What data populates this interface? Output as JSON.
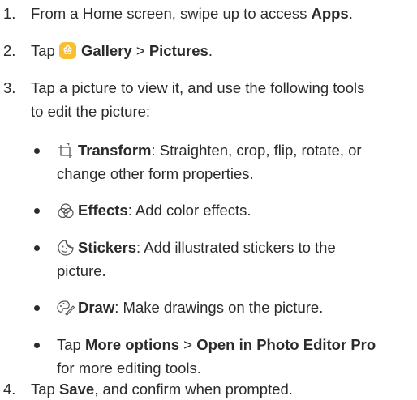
{
  "steps": [
    {
      "num": "1.",
      "prefix": "From a Home screen, swipe up to access ",
      "bold": "Apps",
      "suffix": "."
    },
    {
      "num": "2.",
      "prefix": "Tap ",
      "icon": "gallery-icon",
      "bold1": "Gallery",
      "sep": " > ",
      "bold2": "Pictures",
      "suffix": "."
    },
    {
      "num": "3.",
      "line1": "Tap a picture to view it, and use the following tools",
      "line2": "to edit the picture:"
    },
    {
      "num": "4.",
      "prefix": "Tap ",
      "bold": "Save",
      "suffix": ", and confirm when prompted."
    }
  ],
  "tools": [
    {
      "icon": "transform-icon",
      "name": "Transform",
      "desc_line1": ": Straighten, crop, flip, rotate, or",
      "desc_line2": "change other form properties."
    },
    {
      "icon": "effects-icon",
      "name": "Effects",
      "desc_line1": ": Add color effects."
    },
    {
      "icon": "stickers-icon",
      "name": "Stickers",
      "desc_line1": ": Add illustrated stickers to the",
      "desc_line2": "picture."
    },
    {
      "icon": "draw-icon",
      "name": "Draw",
      "desc_line1": ": Make drawings on the picture."
    },
    {
      "prefix": "Tap ",
      "bold1": "More options",
      "sep": " > ",
      "bold2": "Open in Photo Editor Pro",
      "line2": "for more editing tools."
    }
  ]
}
